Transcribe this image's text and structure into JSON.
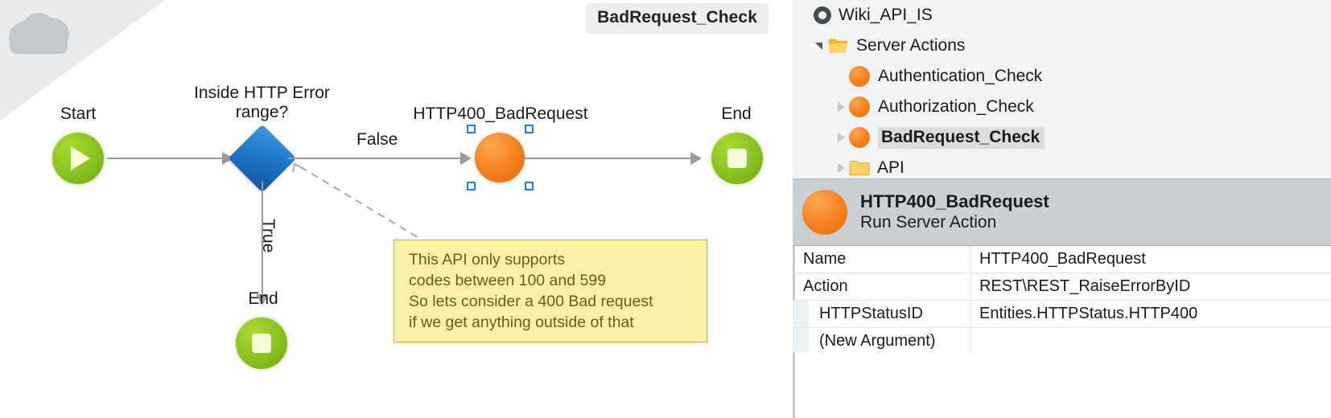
{
  "canvas": {
    "tab_label": "BadRequest_Check",
    "watermark_icon": "cloud-icon",
    "nodes": [
      {
        "id": "start",
        "label": "Start",
        "type": "start-node"
      },
      {
        "id": "decision",
        "label": "Inside HTTP Error range?",
        "type": "decision-node"
      },
      {
        "id": "action",
        "label": "HTTP400_BadRequest",
        "type": "server-action-node",
        "selected": true
      },
      {
        "id": "end-right",
        "label": "End",
        "type": "end-node"
      },
      {
        "id": "end-down",
        "label": "End",
        "type": "end-node"
      }
    ],
    "branches": {
      "false_label": "False",
      "true_label": "True"
    },
    "note": {
      "text": "This API only supports\ncodes between 100 and 599\nSo lets consider a 400 Bad request\nif we get anything outside of that"
    }
  },
  "tree": {
    "items": [
      {
        "label": "Wiki_API_IS",
        "icon": "module-ring-icon",
        "indent": 0,
        "twisty": "none",
        "selected": false
      },
      {
        "label": "Server Actions",
        "icon": "folder-open-icon",
        "indent": 1,
        "twisty": "expanded",
        "selected": false
      },
      {
        "label": "Authentication_Check",
        "icon": "server-action-icon",
        "indent": 2,
        "twisty": "none",
        "selected": false
      },
      {
        "label": "Authorization_Check",
        "icon": "server-action-icon",
        "indent": 2,
        "twisty": "collapsed",
        "selected": false
      },
      {
        "label": "BadRequest_Check",
        "icon": "server-action-icon",
        "indent": 2,
        "twisty": "collapsed",
        "selected": true
      },
      {
        "label": "API",
        "icon": "folder-closed-icon",
        "indent": 2,
        "twisty": "collapsed",
        "selected": false
      }
    ]
  },
  "element_header": {
    "icon": "server-action-icon",
    "title": "HTTP400_BadRequest",
    "subtitle": "Run Server Action"
  },
  "properties": {
    "rows": [
      {
        "key": "Name",
        "value": "HTTP400_BadRequest",
        "indent": false
      },
      {
        "key": "Action",
        "value": "REST\\REST_RaiseErrorByID",
        "indent": false
      },
      {
        "key": "HTTPStatusID",
        "value": "Entities.HTTPStatus.HTTP400",
        "indent": true
      },
      {
        "key": "(New Argument)",
        "value": "",
        "indent": true
      }
    ]
  },
  "colors": {
    "accent_orange": "#f5821f",
    "accent_green": "#8cc422",
    "accent_blue": "#1c72c4",
    "note_yellow": "#faf0a8",
    "selection_blue": "#1b84d8"
  }
}
